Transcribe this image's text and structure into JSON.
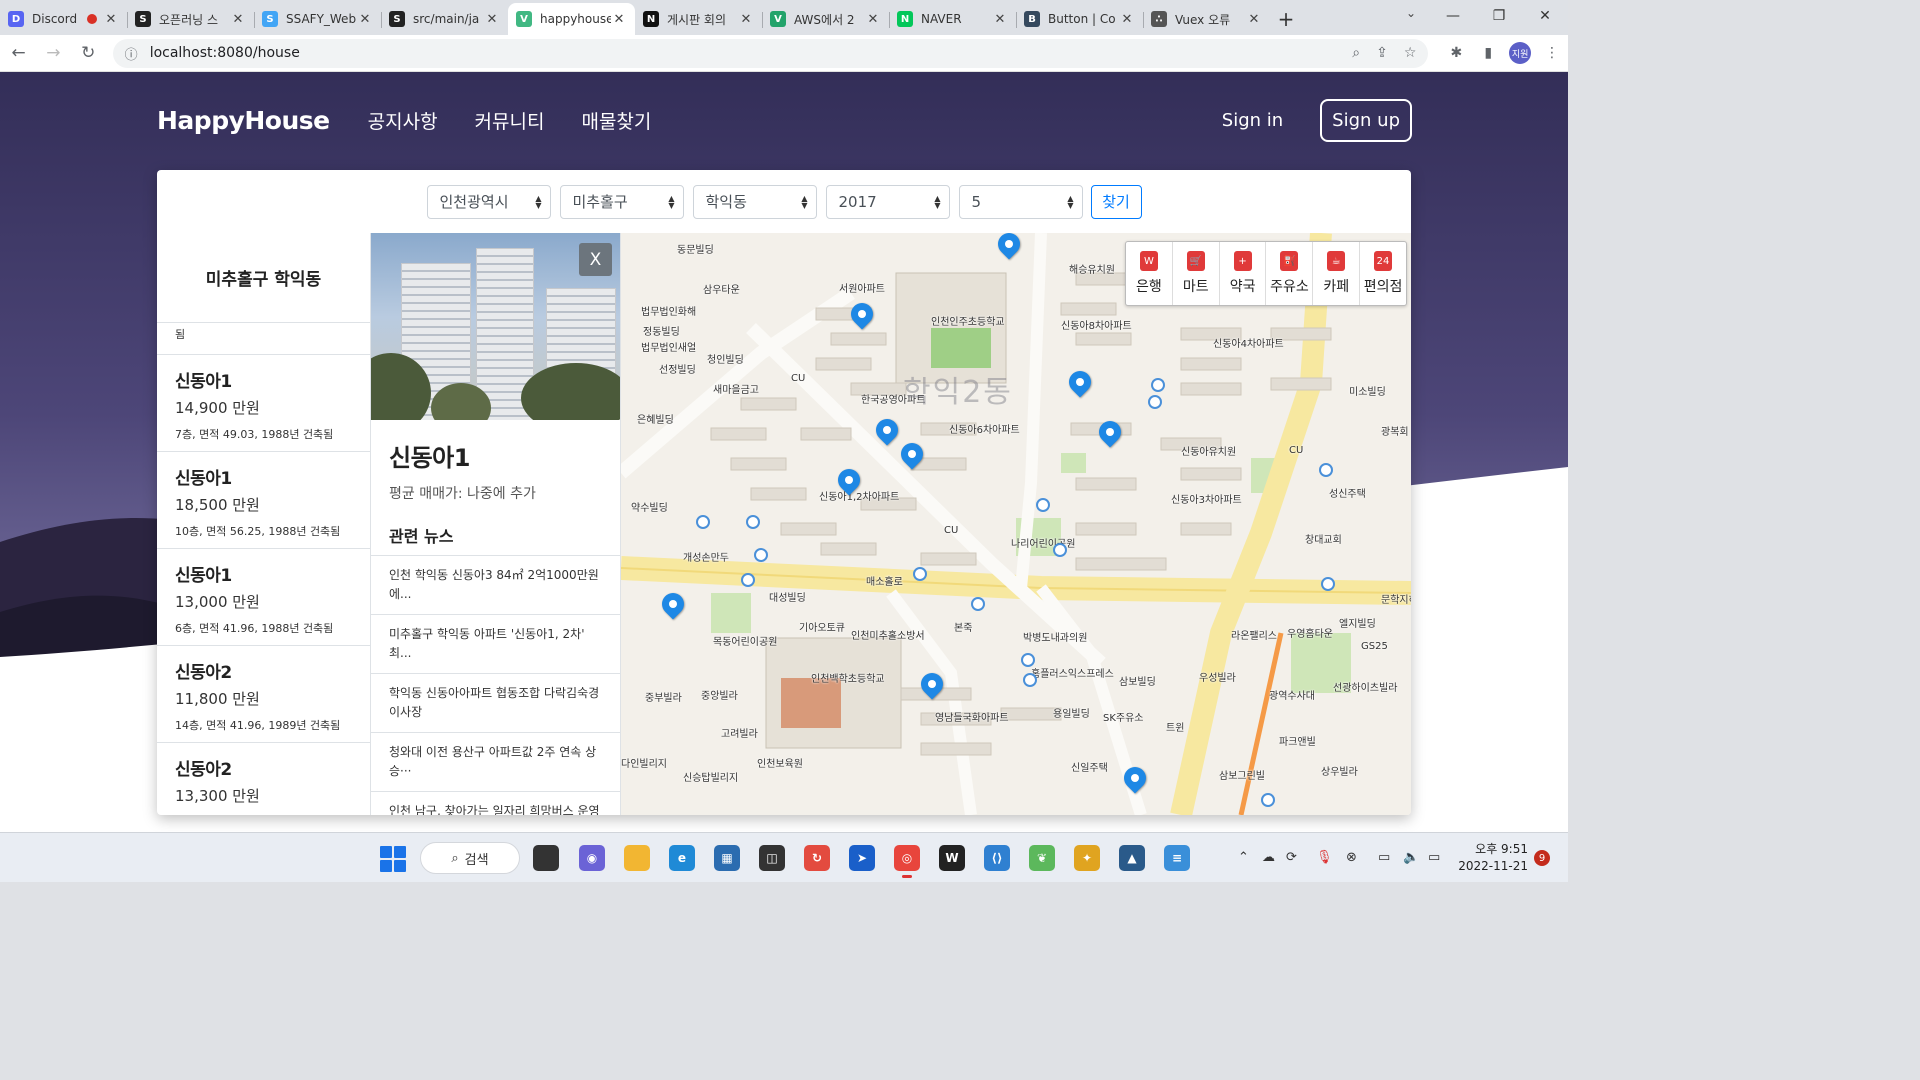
{
  "browser": {
    "tabs": [
      {
        "title": "Discord",
        "fav_color": "#5865f2",
        "fav_glyph": "D",
        "recording": true
      },
      {
        "title": "오픈러닝 스",
        "fav_color": "#222222",
        "fav_glyph": "S"
      },
      {
        "title": "SSAFY_Web",
        "fav_color": "#42a5f5",
        "fav_glyph": "S"
      },
      {
        "title": "src/main/ja",
        "fav_color": "#222222",
        "fav_glyph": "S"
      },
      {
        "title": "happyhouse",
        "fav_color": "#41b883",
        "fav_glyph": "V",
        "active": true
      },
      {
        "title": "게시판 회의",
        "fav_color": "#111111",
        "fav_glyph": "N"
      },
      {
        "title": "AWS에서 2",
        "fav_color": "#23a36b",
        "fav_glyph": "V"
      },
      {
        "title": "NAVER",
        "fav_color": "#03c75a",
        "fav_glyph": "N"
      },
      {
        "title": "Button | Co",
        "fav_color": "#35495e",
        "fav_glyph": "B"
      },
      {
        "title": "Vuex 오류",
        "fav_color": "#555555",
        "fav_glyph": "∴"
      }
    ],
    "url": "localhost:8080/house",
    "profile_initials": "지원"
  },
  "site": {
    "brand": "HappyHouse",
    "nav": [
      "공지사항",
      "커뮤니티",
      "매물찾기"
    ],
    "signin": "Sign in",
    "signup": "Sign up"
  },
  "filters": {
    "city": "인천광역시",
    "district": "미추홀구",
    "dong": "학익동",
    "year": "2017",
    "month": "5",
    "search_button": "찾기"
  },
  "list": {
    "title": "미추홀구 학익동",
    "partial_text": "됨",
    "items": [
      {
        "name": "신동아1",
        "price": "14,900 만원",
        "meta": "7층, 면적 49.03, 1988년 건축됨"
      },
      {
        "name": "신동아1",
        "price": "18,500 만원",
        "meta": "10층, 면적 56.25, 1988년 건축됨"
      },
      {
        "name": "신동아1",
        "price": "13,000 만원",
        "meta": "6층, 면적 41.96, 1988년 건축됨"
      },
      {
        "name": "신동아2",
        "price": "11,800 만원",
        "meta": "14층, 면적 41.96, 1989년 건축됨"
      },
      {
        "name": "신동아2",
        "price": "13,300 만원",
        "meta": ""
      }
    ]
  },
  "detail": {
    "close_label": "X",
    "name": "신동아1",
    "avg_price": "평균 매매가: 나중에 추가",
    "news_heading": "관련 뉴스",
    "news": [
      "인천 학익동 신동아3 84㎡ 2억1000만원에...",
      "미추홀구 학익동 아파트 '신동아1, 2차' 최...",
      "학익동 신동아아파트 협동조합 다락김숙경 이사장",
      "청와대 이전 용산구 아파트값 2주 연속 상승···",
      "인천 남구, 찾아가는 일자리 희망버스 운영"
    ]
  },
  "map": {
    "categories": [
      {
        "label": "은행",
        "icon": "bank-icon"
      },
      {
        "label": "마트",
        "icon": "cart-icon"
      },
      {
        "label": "약국",
        "icon": "pharmacy-icon"
      },
      {
        "label": "주유소",
        "icon": "gas-icon"
      },
      {
        "label": "카페",
        "icon": "cafe-icon"
      },
      {
        "label": "편의점",
        "icon": "store-icon"
      }
    ],
    "area_label": "학익2동",
    "labels": [
      {
        "t": "동문빌딩"
      },
      {
        "t": "삼우타운"
      },
      {
        "t": "법무법인화해"
      },
      {
        "t": "정동빌딩"
      },
      {
        "t": "법무법인새얼"
      },
      {
        "t": "선정빌딩"
      },
      {
        "t": "청인빌딩"
      },
      {
        "t": "새마을금고"
      },
      {
        "t": "은혜빌딩"
      },
      {
        "t": "서원아파트"
      },
      {
        "t": "인천인주초등학교"
      },
      {
        "t": "해승유치원"
      },
      {
        "t": "신동아8차아파트"
      },
      {
        "t": "신동아4차아파트"
      },
      {
        "t": "한국공영아파트"
      },
      {
        "t": "신동아6차아파트"
      },
      {
        "t": "미소빌딩"
      },
      {
        "t": "광복회"
      },
      {
        "t": "신동아유치원"
      },
      {
        "t": "신동아1,2차아파트"
      },
      {
        "t": "신동아3차아파트"
      },
      {
        "t": "성신주택"
      },
      {
        "t": "약수빌딩"
      },
      {
        "t": "개성손만두"
      },
      {
        "t": "나리어린이공원"
      },
      {
        "t": "창대교회"
      },
      {
        "t": "대성빌딩"
      },
      {
        "t": "기아오토큐"
      },
      {
        "t": "인천미추홀소방서"
      },
      {
        "t": "본죽"
      },
      {
        "t": "박병도내과의원"
      },
      {
        "t": "라온팰리스"
      },
      {
        "t": "우영홈타운"
      },
      {
        "t": "엘지빌딩"
      },
      {
        "t": "GS25"
      },
      {
        "t": "목동어린이공원"
      },
      {
        "t": "인천백학초등학교"
      },
      {
        "t": "홈플러스익스프레스"
      },
      {
        "t": "삼보빌딩"
      },
      {
        "t": "우성빌라"
      },
      {
        "t": "광역수사대"
      },
      {
        "t": "선광하이츠빌라"
      },
      {
        "t": "중부빌라"
      },
      {
        "t": "중앙빌라"
      },
      {
        "t": "영남들국화아파트"
      },
      {
        "t": "용일빌딩"
      },
      {
        "t": "SK주유소"
      },
      {
        "t": "트윈"
      },
      {
        "t": "고려빌라"
      },
      {
        "t": "파크앤빌"
      },
      {
        "t": "다인빌리지"
      },
      {
        "t": "인천보육원"
      },
      {
        "t": "신승탑빌리지"
      },
      {
        "t": "신일주택"
      },
      {
        "t": "삼보그린빌"
      },
      {
        "t": "상우빌라"
      },
      {
        "t": "매소홀로"
      },
      {
        "t": "문학지하차도"
      },
      {
        "t": "CU"
      },
      {
        "t": "CU"
      },
      {
        "t": "CU"
      }
    ]
  },
  "taskbar": {
    "search_label": "검색",
    "time": "오후 9:51",
    "date": "2022-11-21",
    "notification_count": "9"
  }
}
